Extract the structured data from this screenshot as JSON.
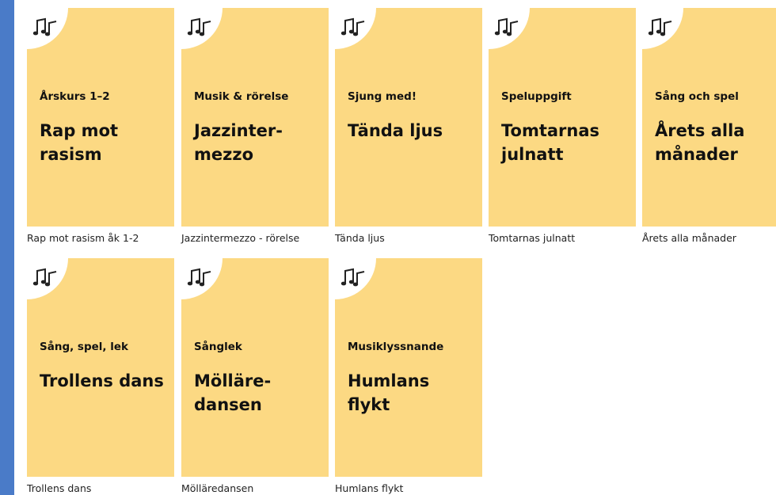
{
  "cards": [
    {
      "category": "Årskurs 1–2",
      "title": "Rap mot\nrasism",
      "caption": "Rap mot rasism åk 1-2"
    },
    {
      "category": "Musik & rörelse",
      "title": "Jazzinter-\nmezzo",
      "caption": "Jazzintermezzo - rörelse"
    },
    {
      "category": "Sjung med!",
      "title": "Tända ljus",
      "caption": "Tända ljus"
    },
    {
      "category": "Speluppgift",
      "title": "Tomtarnas\njulnatt",
      "caption": "Tomtarnas julnatt"
    },
    {
      "category": "Sång och spel",
      "title": "Årets alla\nmånader",
      "caption": "Årets alla månader"
    },
    {
      "category": "Sång, spel, lek",
      "title": "Trollens dans",
      "caption": "Trollens dans"
    },
    {
      "category": "Sånglek",
      "title": "Mölläre-\ndansen",
      "caption": "Mölläredansen"
    },
    {
      "category": "Musiklyssnande",
      "title": "Humlans\nflykt",
      "caption": "Humlans flykt"
    }
  ],
  "colors": {
    "card_background": "#fcd983",
    "left_strip": "#4a7bc8",
    "icon_stroke": "#222222"
  },
  "icons": {
    "card_icon": "music-notes-icon"
  }
}
